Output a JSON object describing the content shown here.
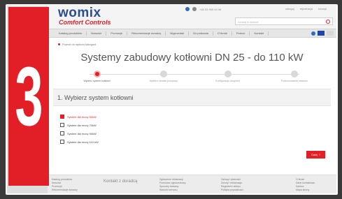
{
  "badge": {
    "number": "3"
  },
  "header": {
    "logo_main": "womix",
    "logo_sub": "Comfort Controls",
    "contact_info": "+48 53 955 44 08",
    "account": {
      "login": "zaloguj",
      "register": "rejestracja",
      "cart": "koszyk"
    },
    "search_placeholder": "Szukaj w sklepie"
  },
  "nav": {
    "items": [
      "Katalog produktów",
      "Nowości",
      "Promocje",
      "Rekomendacje doradcy",
      "Wyprzedaż",
      "Do pobrania",
      "O firmie",
      "Pomoc",
      "Kontakt"
    ]
  },
  "breadcrumb": "Powrót do wyboru kategorii",
  "page": {
    "title": "Systemy zabudowy kotłowni DN 25 - do 110 kW"
  },
  "steps": [
    {
      "label": "Wybierz system kotłowni",
      "active": true
    },
    {
      "label": "Wybierz zestaw pompowy",
      "active": false
    },
    {
      "label": "Konfiguracja urządzeń",
      "active": false
    },
    {
      "label": "Podsumowanie zestawu",
      "active": false
    }
  ],
  "section": {
    "title": "1. Wybierz system kotłowni",
    "options": [
      {
        "label": "System dla mocy 50kW",
        "checked": true
      },
      {
        "label": "System dla mocy 70kW",
        "checked": false
      },
      {
        "label": "System dla mocy 90kW",
        "checked": false
      },
      {
        "label": "System dla mocy 110 kW",
        "checked": false
      }
    ],
    "next_label": "Dalej"
  },
  "footer": {
    "col1": [
      "Katalog produktów",
      "Nowości",
      "Promocje",
      "Rekomendacje doradcy"
    ],
    "brand": "Kontakt z doradcą",
    "col2": [
      "Zgłoszenie reklamacji",
      "Formularz zgłoszeniowy",
      "Sposoby dostawy",
      "Warunki serwisu"
    ],
    "col3": [
      "Zakupy i płatności",
      "Zwroty i reklamacje",
      "Regulamin sklepu",
      "Polityka prywatności"
    ],
    "col4": [
      "O firmie",
      "Dane kontaktowe",
      "Kariera",
      "Mapa strony"
    ]
  },
  "colors": {
    "accent": "#e21e26",
    "brand_blue": "#2a4e8f",
    "frame": "#ffffff",
    "background": "#3a3a3a"
  }
}
